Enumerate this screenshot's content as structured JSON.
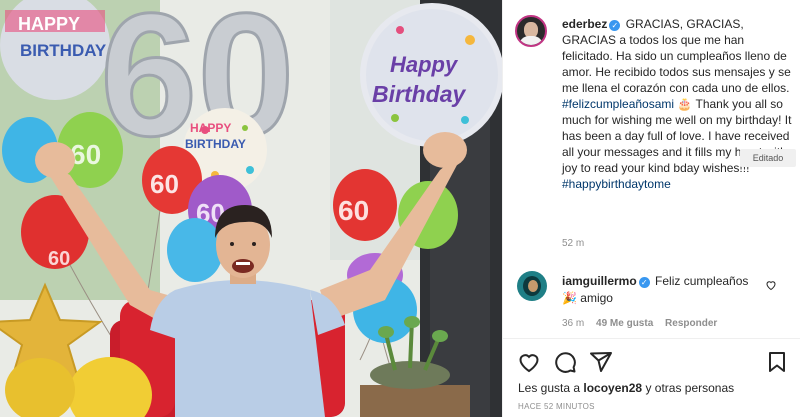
{
  "photo": {
    "balloon_text_60": "60",
    "big_number": "60",
    "balloon_happy": "Happy",
    "balloon_birthday": "Birthday",
    "topleft_happy": "HAPPY",
    "topleft_birthday": "BIRTHDAY",
    "mid_happy": "HAPPY",
    "mid_birthday": "BIRTHDAY"
  },
  "post": {
    "username": "ederbez",
    "caption_es": "GRACIAS, GRACIAS, GRACIAS a todos los que me han felicitado. Ha sido un cumpleaños lleno de amor. He recibido todos sus mensajes y se me llena el corazón con cada uno de ellos.",
    "hashtag_es": "#felizcumpleañosami",
    "emoji_cake": "🎂",
    "caption_en": "Thank you all so much for wishing me well on my birthday! It has been a day full of love. I have received all your messages and it fills my heart with joy to read your kind bday wishes!!!",
    "hashtag_en": "#happybirthdaytome",
    "edited_tooltip": "Editado",
    "time": "52 m"
  },
  "comment": {
    "username": "iamguillermo",
    "text_1": "Feliz cumpleaños",
    "emoji": "🎉",
    "text_2": "amigo",
    "time": "36 m",
    "likes": "49 Me gusta",
    "reply": "Responder"
  },
  "footer": {
    "likes_prefix": "Les gusta a",
    "likes_user": "locoyen28",
    "likes_suffix": "y otras personas",
    "ago": "HACE 52 MINUTOS"
  },
  "icons": {
    "verified": "✓",
    "like": "heart-icon",
    "comment": "comment-icon",
    "share": "send-icon",
    "save": "bookmark-icon"
  },
  "colors": {
    "verified_blue": "#3897f0",
    "hashtag": "#00376b",
    "muted": "#8e8e8e"
  }
}
